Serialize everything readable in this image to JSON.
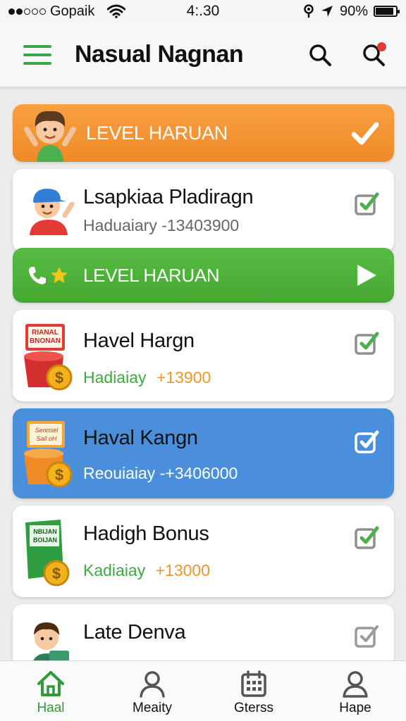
{
  "status_bar": {
    "carrier": "Gopaik",
    "time": "4:.30",
    "battery": "90%",
    "battery_level": 0.9
  },
  "app_bar": {
    "title": "Nasual Nagnan",
    "menu_icon": "hamburger-menu-icon",
    "search_icon": "search-icon",
    "search_alert_icon": "search-notification-icon",
    "accent": "#3aa64a"
  },
  "banners": [
    {
      "label": "LEVEL HARUAN",
      "color": "#f28f2f",
      "action_icon": "checkmark-icon"
    },
    {
      "label": "LEVEL HARUAN",
      "color": "#4cae39",
      "action_icon": "play-icon"
    }
  ],
  "cards": [
    {
      "title": "Lsapkiaa Pladiragn",
      "subtitle": "Haduaiary -13403900",
      "subtitle_style": "gray"
    },
    {
      "title": "Havel Hargn",
      "subtitle_label": "Hadiaiay",
      "subtitle_amount": "+13900",
      "thumb_text": "RIANAL BNONAN"
    },
    {
      "title": "Haval Kangn",
      "subtitle": "Reouiaiay -+3406000",
      "thumb_text": "Sennsel Sall oH",
      "color": "#4a8fdc"
    },
    {
      "title": "Hadigh Bonus",
      "subtitle_label": "Kadiaiay",
      "subtitle_amount": "+13000",
      "thumb_text": "NBIJAN BOIJAN"
    },
    {
      "title": "Late Denva"
    }
  ],
  "bottom_nav": [
    {
      "label": "Haal",
      "icon": "home-icon",
      "active": true
    },
    {
      "label": "Meaity",
      "icon": "person-icon",
      "active": false
    },
    {
      "label": "Gterss",
      "icon": "calendar-icon",
      "active": false
    },
    {
      "label": "Hape",
      "icon": "profile-icon",
      "active": false
    }
  ]
}
